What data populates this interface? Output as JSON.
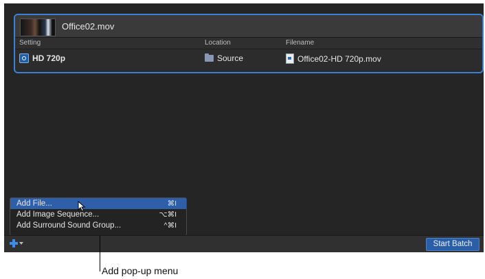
{
  "job": {
    "title": "Office02.mov",
    "columns": {
      "setting": "Setting",
      "location": "Location",
      "filename": "Filename"
    },
    "row": {
      "setting": "HD 720p",
      "location": "Source",
      "filename": "Office02-HD 720p.mov"
    }
  },
  "menu": {
    "items": [
      {
        "label": "Add File...",
        "shortcut": "⌘I"
      },
      {
        "label": "Add Image Sequence...",
        "shortcut": "⌥⌘I"
      },
      {
        "label": "Add Surround Sound Group...",
        "shortcut": "^⌘I"
      }
    ]
  },
  "toolbar": {
    "start_label": "Start Batch"
  },
  "callout": {
    "text": "Add pop-up menu"
  },
  "colors": {
    "accent": "#3b82d6",
    "menu_highlight": "#2f5fa8",
    "background": "#252525"
  },
  "icons": [
    "setting-icon",
    "folder-icon",
    "movie-file-icon",
    "add-plus-icon",
    "cursor-icon"
  ]
}
